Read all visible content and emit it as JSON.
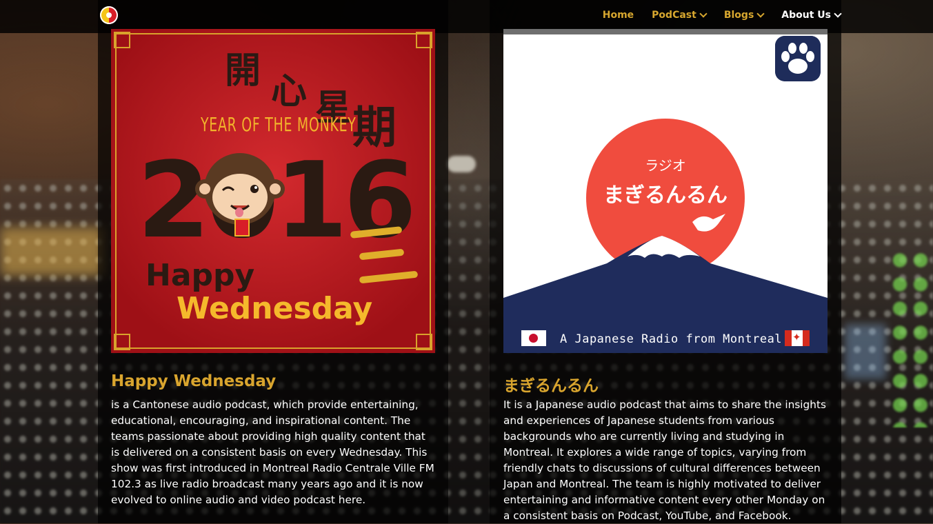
{
  "nav": {
    "items": [
      {
        "label": "Home",
        "has_dropdown": false,
        "active": false
      },
      {
        "label": "PodCast",
        "has_dropdown": true,
        "active": false
      },
      {
        "label": "Blogs",
        "has_dropdown": true,
        "active": false
      },
      {
        "label": "About Us",
        "has_dropdown": true,
        "active": true
      }
    ]
  },
  "colors": {
    "accent": "#d9a52e",
    "nav_active": "#ffffff",
    "overlay": "rgba(0,0,0,0.72)"
  },
  "cards": [
    {
      "poster": {
        "chinese_title": "開心星期",
        "subtitle": "YEAR OF THE MONKEY",
        "year": "2016",
        "line1": "Happy",
        "line2": "Wednesday"
      },
      "title": "Happy Wednesday",
      "description": "is a Cantonese audio podcast, which provide entertaining, educational, encouraging, and inspirational content. The teams passionate about providing high quality content that is delivered on a consistent basis on every Wednesday. This show was first introduced in Montreal Radio Centrale Ville FM 102.3 as live radio broadcast many years ago and it is now evolved to online audio and video podcast here."
    },
    {
      "poster": {
        "small_text": "ラジオ",
        "big_text": "まぎるんるん",
        "tagline": "A Japanese Radio from Montreal",
        "icon": "paw-icon"
      },
      "title": "まぎるんるん",
      "description": "It is a Japanese audio podcast that aims to share the insights and experiences of Japanese students from various backgrounds who are currently living and studying in Montreal. It explores a wide range of topics, varying from friendly chats to discussions of cultural differences between Japan and Montreal. The team is highly motivated to deliver entertaining and informative content every other Monday on a consistent basis on Podcast, YouTube, and Facebook."
    }
  ]
}
